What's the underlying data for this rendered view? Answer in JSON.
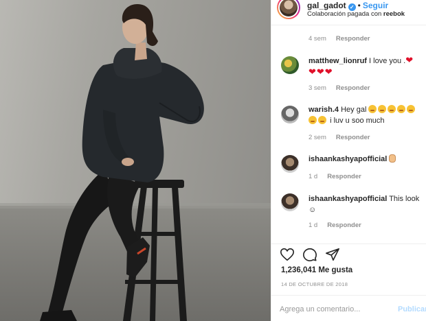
{
  "post": {
    "photo_alt": "Mujer sentada en un taburete de madera negro con sudadera con capucha y mallas negras"
  },
  "header": {
    "username": "gal_gadot",
    "separator": "•",
    "follow_label": "Seguir",
    "paid_partnership_prefix": "Colaboración pagada con",
    "partner": "reebok",
    "verified_glyph": "✓"
  },
  "comments": [
    {
      "time": "4 sem",
      "reply_label": "Responder"
    },
    {
      "user": "matthew_lionruf",
      "text": "I love you .",
      "hearts": "❤ ❤❤❤",
      "time": "3 sem",
      "reply_label": "Responder"
    },
    {
      "user": "warish.4",
      "text_a": "Hey gal",
      "text_b": "i luv u soo much",
      "time": "2 sem",
      "reply_label": "Responder"
    },
    {
      "user": "ishaankashyapofficial",
      "time": "1 d",
      "reply_label": "Responder"
    },
    {
      "user": "ishaankashyapofficial",
      "text": "This look",
      "text_b": "☺",
      "time": "1 d",
      "reply_label": "Responder"
    }
  ],
  "actions": {
    "likes": "1,236,041 Me gusta",
    "date": "14 DE OCTUBRE DE 2018"
  },
  "composer": {
    "placeholder": "Agrega un comentario...",
    "publish_label": "Publicar"
  }
}
